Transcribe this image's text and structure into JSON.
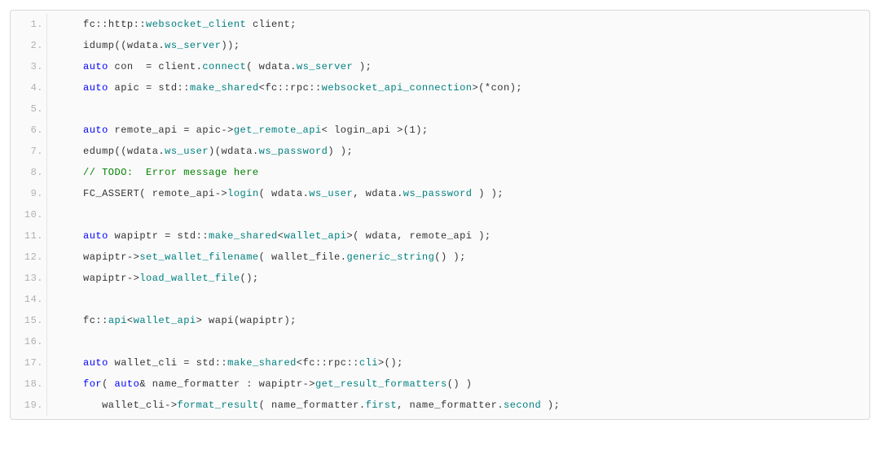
{
  "lines": [
    {
      "n": "1.",
      "tokens": [
        {
          "c": "id",
          "t": "fc"
        },
        {
          "c": "",
          "t": "::"
        },
        {
          "c": "id",
          "t": "http"
        },
        {
          "c": "",
          "t": "::"
        },
        {
          "c": "mem",
          "t": "websocket_client"
        },
        {
          "c": "",
          "t": " client;"
        }
      ]
    },
    {
      "n": "2.",
      "tokens": [
        {
          "c": "",
          "t": "idump((wdata."
        },
        {
          "c": "mem",
          "t": "ws_server"
        },
        {
          "c": "",
          "t": "));"
        }
      ]
    },
    {
      "n": "3.",
      "tokens": [
        {
          "c": "kw",
          "t": "auto"
        },
        {
          "c": "",
          "t": " con  = client."
        },
        {
          "c": "mem",
          "t": "connect"
        },
        {
          "c": "",
          "t": "( wdata."
        },
        {
          "c": "mem",
          "t": "ws_server"
        },
        {
          "c": "",
          "t": " );"
        }
      ]
    },
    {
      "n": "4.",
      "tokens": [
        {
          "c": "kw",
          "t": "auto"
        },
        {
          "c": "",
          "t": " apic = std::"
        },
        {
          "c": "mem",
          "t": "make_shared"
        },
        {
          "c": "",
          "t": "<fc::rpc::"
        },
        {
          "c": "mem",
          "t": "websocket_api_connection"
        },
        {
          "c": "",
          "t": ">(*con);"
        }
      ]
    },
    {
      "n": "5.",
      "tokens": [
        {
          "c": "",
          "t": ""
        }
      ]
    },
    {
      "n": "6.",
      "tokens": [
        {
          "c": "kw",
          "t": "auto"
        },
        {
          "c": "",
          "t": " remote_api = apic->"
        },
        {
          "c": "mem",
          "t": "get_remote_api"
        },
        {
          "c": "",
          "t": "< login_api >(1);"
        }
      ]
    },
    {
      "n": "7.",
      "tokens": [
        {
          "c": "",
          "t": "edump((wdata."
        },
        {
          "c": "mem",
          "t": "ws_user"
        },
        {
          "c": "",
          "t": ")(wdata."
        },
        {
          "c": "mem",
          "t": "ws_password"
        },
        {
          "c": "",
          "t": ") );"
        }
      ]
    },
    {
      "n": "8.",
      "tokens": [
        {
          "c": "cmt",
          "t": "// TODO:  Error message here"
        }
      ]
    },
    {
      "n": "9.",
      "tokens": [
        {
          "c": "",
          "t": "FC_ASSERT( remote_api->"
        },
        {
          "c": "mem",
          "t": "login"
        },
        {
          "c": "",
          "t": "( wdata."
        },
        {
          "c": "mem",
          "t": "ws_user"
        },
        {
          "c": "",
          "t": ", wdata."
        },
        {
          "c": "mem",
          "t": "ws_password"
        },
        {
          "c": "",
          "t": " ) );"
        }
      ]
    },
    {
      "n": "10.",
      "tokens": [
        {
          "c": "",
          "t": ""
        }
      ]
    },
    {
      "n": "11.",
      "tokens": [
        {
          "c": "kw",
          "t": "auto"
        },
        {
          "c": "",
          "t": " wapiptr = std::"
        },
        {
          "c": "mem",
          "t": "make_shared"
        },
        {
          "c": "",
          "t": "<"
        },
        {
          "c": "mem",
          "t": "wallet_api"
        },
        {
          "c": "",
          "t": ">( wdata, remote_api );"
        }
      ]
    },
    {
      "n": "12.",
      "tokens": [
        {
          "c": "",
          "t": "wapiptr->"
        },
        {
          "c": "mem",
          "t": "set_wallet_filename"
        },
        {
          "c": "",
          "t": "( wallet_file."
        },
        {
          "c": "mem",
          "t": "generic_string"
        },
        {
          "c": "",
          "t": "() );"
        }
      ]
    },
    {
      "n": "13.",
      "tokens": [
        {
          "c": "",
          "t": "wapiptr->"
        },
        {
          "c": "mem",
          "t": "load_wallet_file"
        },
        {
          "c": "",
          "t": "();"
        }
      ]
    },
    {
      "n": "14.",
      "tokens": [
        {
          "c": "",
          "t": ""
        }
      ]
    },
    {
      "n": "15.",
      "tokens": [
        {
          "c": "",
          "t": "fc::"
        },
        {
          "c": "mem",
          "t": "api"
        },
        {
          "c": "",
          "t": "<"
        },
        {
          "c": "mem",
          "t": "wallet_api"
        },
        {
          "c": "",
          "t": "> wapi(wapiptr);"
        }
      ]
    },
    {
      "n": "16.",
      "tokens": [
        {
          "c": "",
          "t": ""
        }
      ]
    },
    {
      "n": "17.",
      "tokens": [
        {
          "c": "kw",
          "t": "auto"
        },
        {
          "c": "",
          "t": " wallet_cli = std::"
        },
        {
          "c": "mem",
          "t": "make_shared"
        },
        {
          "c": "",
          "t": "<fc::rpc::"
        },
        {
          "c": "mem",
          "t": "cli"
        },
        {
          "c": "",
          "t": ">();"
        }
      ]
    },
    {
      "n": "18.",
      "tokens": [
        {
          "c": "kw",
          "t": "for"
        },
        {
          "c": "",
          "t": "( "
        },
        {
          "c": "kw",
          "t": "auto"
        },
        {
          "c": "",
          "t": "& name_formatter : wapiptr->"
        },
        {
          "c": "mem",
          "t": "get_result_formatters"
        },
        {
          "c": "",
          "t": "() )"
        }
      ]
    },
    {
      "n": "19.",
      "tokens": [
        {
          "c": "",
          "t": "   wallet_cli->"
        },
        {
          "c": "mem",
          "t": "format_result"
        },
        {
          "c": "",
          "t": "( name_formatter."
        },
        {
          "c": "mem",
          "t": "first"
        },
        {
          "c": "",
          "t": ", name_formatter."
        },
        {
          "c": "mem",
          "t": "second"
        },
        {
          "c": "",
          "t": " );"
        }
      ]
    }
  ]
}
